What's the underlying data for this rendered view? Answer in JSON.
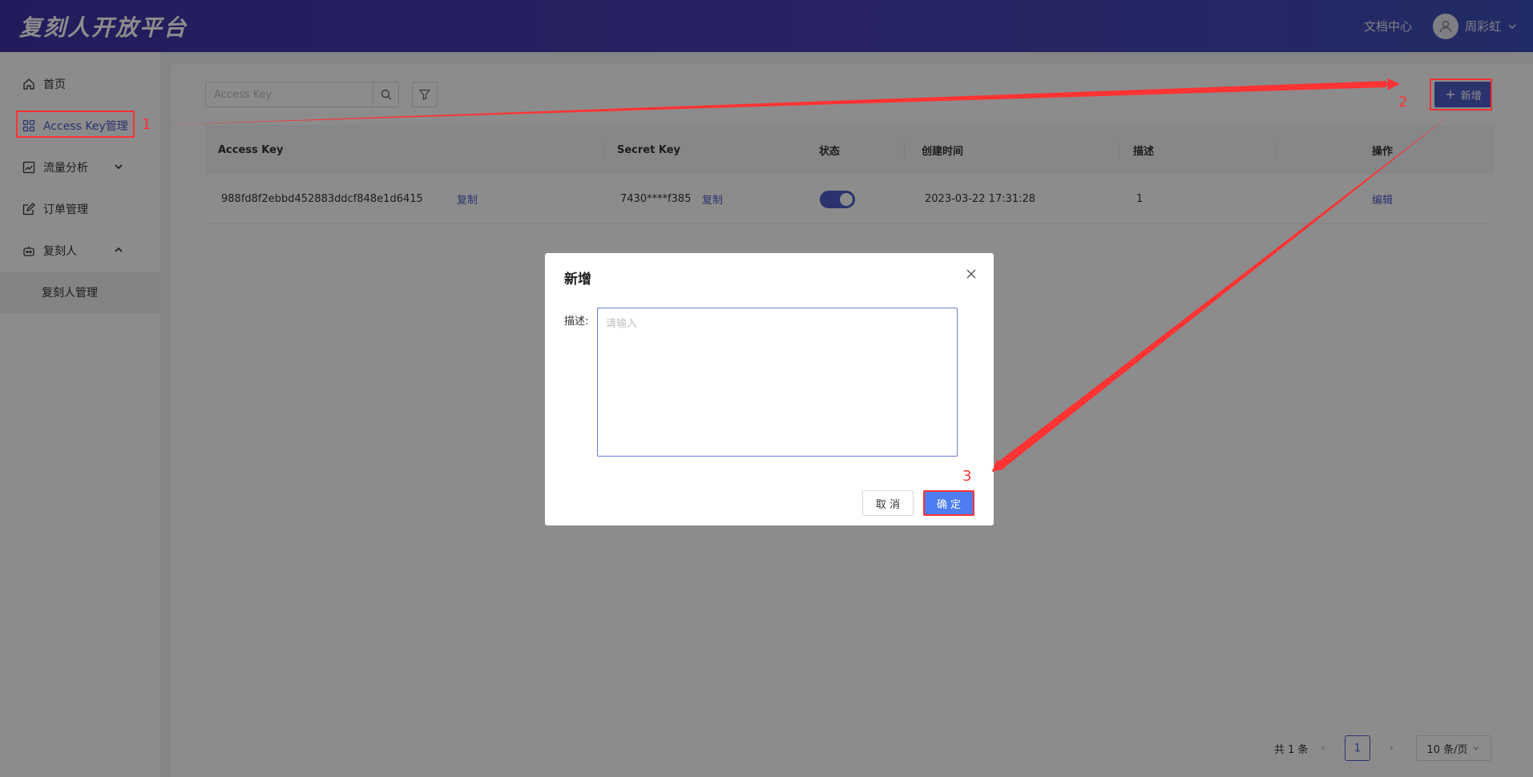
{
  "header": {
    "logo": "复刻人开放平台",
    "docs_link": "文档中心",
    "user_name": "周彩虹"
  },
  "sidebar": {
    "items": [
      {
        "label": "首页",
        "icon": "home-icon"
      },
      {
        "label": "Access Key管理",
        "icon": "grid-icon",
        "active": true
      },
      {
        "label": "流量分析",
        "icon": "chart-icon",
        "expandable": true,
        "expanded": false
      },
      {
        "label": "订单管理",
        "icon": "edit-doc-icon"
      },
      {
        "label": "复刻人",
        "icon": "robot-icon",
        "expandable": true,
        "expanded": true
      }
    ],
    "sub_items": [
      {
        "label": "复刻人管理"
      }
    ]
  },
  "toolbar": {
    "search_placeholder": "Access Key",
    "add_label": "新增"
  },
  "table": {
    "headers": [
      "Access Key",
      "Secret Key",
      "状态",
      "创建时间",
      "描述",
      "操作"
    ],
    "rows": [
      {
        "access_key": "988fd8f2ebbd452883ddcf848e1d6415",
        "copy_ak": "复制",
        "secret_key": "7430****f385",
        "copy_sk": "复制",
        "status_on": true,
        "created": "2023-03-22 17:31:28",
        "desc": "1",
        "action": "编辑"
      }
    ]
  },
  "pagination": {
    "total": "共 1 条",
    "current_page": "1",
    "page_size": "10 条/页"
  },
  "modal": {
    "title": "新增",
    "desc_label": "描述:",
    "desc_placeholder": "请输入",
    "cancel_label": "取 消",
    "ok_label": "确 定"
  },
  "annotations": {
    "step1": "1",
    "step2": "2",
    "step3": "3",
    "color": "#ff3333"
  },
  "colors": {
    "accent": "#4e5ec9",
    "header_start": "#3f33a8",
    "header_end": "#3d4fb8",
    "ok_button": "#4e7cf2"
  }
}
